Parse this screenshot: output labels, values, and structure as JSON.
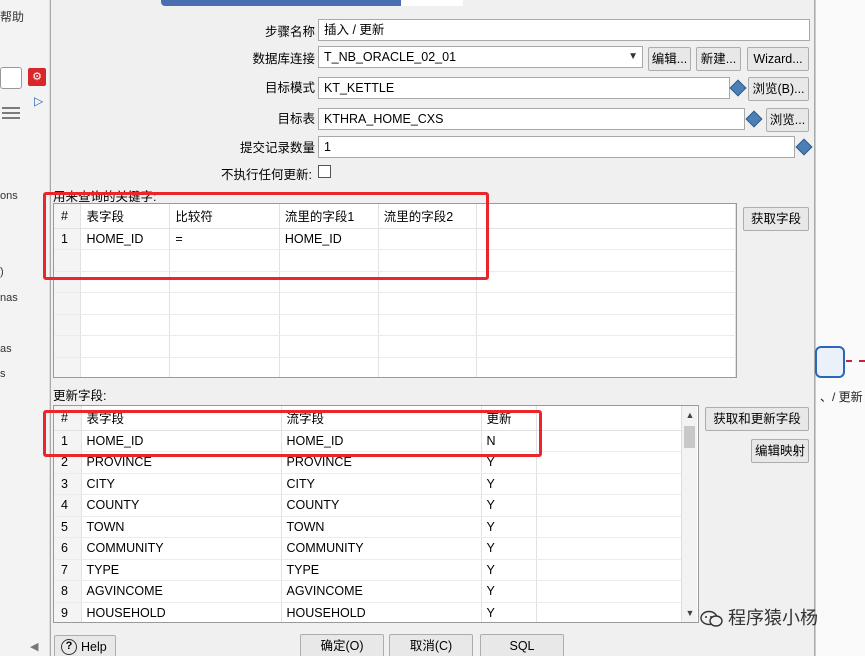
{
  "background": {
    "menu_help": "帮助",
    "frag_ons": "ons",
    "frag_paren": ")",
    "frag_nas": "nas",
    "frag_as": "as",
    "frag_s": "s",
    "node_label": "、/ 更新"
  },
  "dialog": {
    "step_name_label": "步骤名称",
    "step_name_value": "插入 / 更新",
    "db_conn_label": "数据库连接",
    "db_conn_value": "T_NB_ORACLE_02_01",
    "edit_button": "编辑...",
    "new_button": "新建...",
    "wizard_button": "Wizard...",
    "target_schema_label": "目标模式",
    "target_schema_value": "KT_KETTLE",
    "browse_b_button": "浏览(B)...",
    "target_table_label": "目标表",
    "target_table_value": "KTHRA_HOME_CXS",
    "browse_button": "浏览...",
    "commit_size_label": "提交记录数量",
    "commit_size_value": "1",
    "no_update_label": "不执行任何更新:",
    "key_section_label": "用来查询的关键字:",
    "get_fields_button": "获取字段",
    "update_section_label": "更新字段:",
    "get_update_fields_button": "获取和更新字段",
    "edit_mapping_button": "编辑映射",
    "help_button": "Help",
    "ok_button": "确定(O)",
    "cancel_button": "取消(C)",
    "sql_button": "SQL"
  },
  "key_table": {
    "headers": [
      "#",
      "表字段",
      "比较符",
      "流里的字段1",
      "流里的字段2"
    ],
    "rows": [
      [
        "1",
        "HOME_ID",
        "=",
        "HOME_ID",
        ""
      ]
    ]
  },
  "update_table": {
    "headers": [
      "#",
      "表字段",
      "流字段",
      "更新"
    ],
    "rows": [
      [
        "1",
        "HOME_ID",
        "HOME_ID",
        "N"
      ],
      [
        "2",
        "PROVINCE",
        "PROVINCE",
        "Y"
      ],
      [
        "3",
        "CITY",
        "CITY",
        "Y"
      ],
      [
        "4",
        "COUNTY",
        "COUNTY",
        "Y"
      ],
      [
        "5",
        "TOWN",
        "TOWN",
        "Y"
      ],
      [
        "6",
        "COMMUNITY",
        "COMMUNITY",
        "Y"
      ],
      [
        "7",
        "TYPE",
        "TYPE",
        "Y"
      ],
      [
        "8",
        "AGVINCOME",
        "AGVINCOME",
        "Y"
      ],
      [
        "9",
        "HOUSEHOLD",
        "HOUSEHOLD",
        "Y"
      ]
    ]
  },
  "watermark": "程序猿小杨",
  "colors": {
    "highlight": "#e8262c",
    "accent": "#4a6fb0"
  }
}
